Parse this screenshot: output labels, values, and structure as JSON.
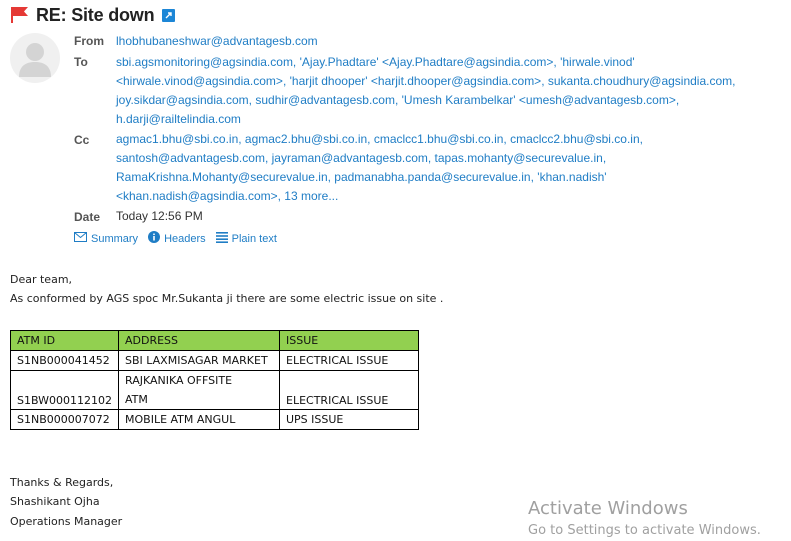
{
  "subject": {
    "title": "RE: Site down"
  },
  "header": {
    "from_label": "From",
    "from": "lhobhubaneshwar@advantagesb.com",
    "to_label": "To",
    "to_lines": [
      "sbi.agsmonitoring@agsindia.com, 'Ajay.Phadtare' <Ajay.Phadtare@agsindia.com>, 'hirwale.vinod'",
      "<hirwale.vinod@agsindia.com>, 'harjit dhooper' <harjit.dhooper@agsindia.com>, sukanta.choudhury@agsindia.com,",
      "joy.sikdar@agsindia.com, sudhir@advantagesb.com, 'Umesh Karambelkar' <umesh@advantagesb.com>,",
      "h.darji@railtelindia.com"
    ],
    "cc_label": "Cc",
    "cc_lines": [
      "agmac1.bhu@sbi.co.in, agmac2.bhu@sbi.co.in, cmaclcc1.bhu@sbi.co.in, cmaclcc2.bhu@sbi.co.in,",
      "santosh@advantagesb.com, jayraman@advantagesb.com, tapas.mohanty@securevalue.in,",
      "RamaKrishna.Mohanty@securevalue.in, padmanabha.panda@securevalue.in, 'khan.nadish'",
      "<khan.nadish@agsindia.com>,"
    ],
    "cc_more": "13 more...",
    "date_label": "Date",
    "date": "Today 12:56 PM"
  },
  "view_links": {
    "summary": "Summary",
    "headers": "Headers",
    "plain_text": "Plain text"
  },
  "body": {
    "greeting": "Dear team,",
    "line1": "As conformed by AGS spoc Mr.Sukanta ji there are some electric issue on site .",
    "table": {
      "headers": [
        "ATM ID",
        "ADDRESS",
        "ISSUE"
      ],
      "rows": [
        {
          "atm_id": "S1NB000041452",
          "address_lines": [
            "SBI LAXMISAGAR MARKET"
          ],
          "issue": "ELECTRICAL ISSUE"
        },
        {
          "atm_id": "S1BW000112102",
          "address_lines": [
            "RAJKANIKA  OFFSITE",
            "ATM"
          ],
          "issue": "ELECTRICAL ISSUE"
        },
        {
          "atm_id": "S1NB000007072",
          "address_lines": [
            "MOBILE ATM ANGUL"
          ],
          "issue": "UPS ISSUE"
        }
      ],
      "header_color": "#92d050"
    },
    "signoff": "Thanks & Regards,",
    "name": "Shashikant Ojha",
    "role": "Operations Manager"
  },
  "watermark": {
    "line1": "Activate Windows",
    "line2": "Go to Settings to activate Windows."
  },
  "colors": {
    "link": "#1f7dc5",
    "flag": "#e53935",
    "accent": "#1c86d6"
  }
}
